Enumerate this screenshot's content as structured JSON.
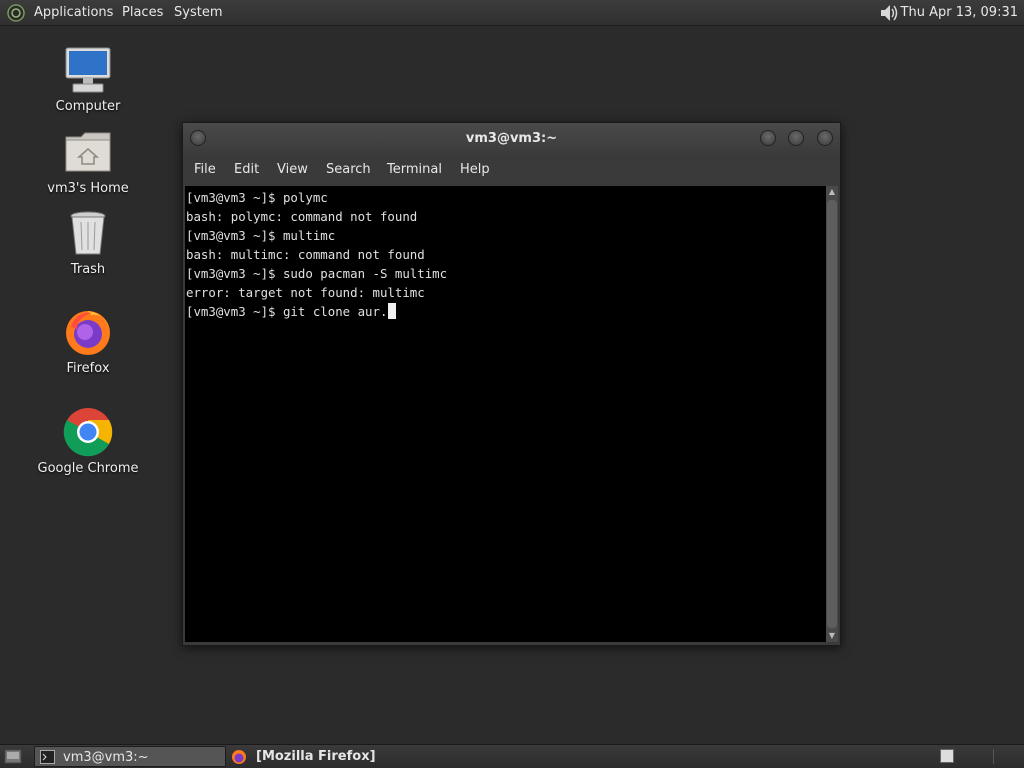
{
  "top_panel": {
    "menus": [
      "Applications",
      "Places",
      "System"
    ],
    "clock": "Thu Apr 13, 09:31",
    "volume_icon": "volume-icon"
  },
  "desktop_icons": [
    {
      "label": "Computer",
      "icon": "computer-icon"
    },
    {
      "label": "vm3's Home",
      "icon": "home-folder-icon"
    },
    {
      "label": "Trash",
      "icon": "trash-icon"
    },
    {
      "label": "Firefox",
      "icon": "firefox-icon"
    },
    {
      "label": "Google Chrome",
      "icon": "chrome-icon"
    }
  ],
  "terminal": {
    "title": "vm3@vm3:~",
    "menu": [
      "File",
      "Edit",
      "View",
      "Search",
      "Terminal",
      "Help"
    ],
    "lines": [
      "[vm3@vm3 ~]$ polymc",
      "bash: polymc: command not found",
      "[vm3@vm3 ~]$ multimc",
      "bash: multimc: command not found",
      "[vm3@vm3 ~]$ sudo pacman -S multimc",
      "error: target not found: multimc",
      "[vm3@vm3 ~]$ git clone aur."
    ]
  },
  "taskbar": {
    "tasks": [
      {
        "label": "vm3@vm3:~",
        "icon": "terminal-icon",
        "active": true
      },
      {
        "label": "[Mozilla Firefox]",
        "icon": "firefox-icon",
        "active": false
      }
    ]
  },
  "colors": {
    "desktop": "#2b2b2b",
    "terminal_bg": "#000000",
    "terminal_fg": "#e0e0e0"
  }
}
